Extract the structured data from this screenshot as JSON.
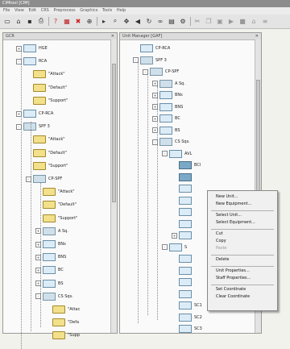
{
  "window": {
    "title": "CIMtool [CIM]"
  },
  "menu": [
    "File",
    "View",
    "Edit",
    "CRS",
    "Preprocess",
    "Graphics",
    "Tools",
    "Help"
  ],
  "toolbar_icons": [
    "new-icon",
    "open-icon",
    "save-icon",
    "print-icon",
    "help-icon",
    "grid-icon",
    "delete-icon",
    "zoom-icon",
    "select-icon",
    "search-icon",
    "pan-icon",
    "back-icon",
    "refresh-icon",
    "link-icon",
    "chart-icon",
    "settings-icon",
    "cut-icon",
    "copy-icon",
    "paste-icon",
    "forward-icon",
    "stop-icon",
    "home-icon",
    "layers-icon"
  ],
  "left_panel": {
    "title": "GCR",
    "rows": [
      {
        "label": "HGE",
        "icon": "unit",
        "exp": "+"
      },
      {
        "label": "RCA",
        "icon": "unit",
        "exp": "-"
      },
      {
        "label": "\"Attack\"",
        "icon": "folder",
        "exp": ""
      },
      {
        "label": "\"Default\"",
        "icon": "folder",
        "exp": ""
      },
      {
        "label": "\"Support\"",
        "icon": "folder",
        "exp": ""
      },
      {
        "label": "CP-RCA",
        "icon": "unit",
        "exp": "+"
      },
      {
        "label": "SPF 3",
        "icon": "gear",
        "exp": "-"
      },
      {
        "label": "\"Attack\"",
        "icon": "folder",
        "exp": ""
      },
      {
        "label": "\"Default\"",
        "icon": "folder",
        "exp": ""
      },
      {
        "label": "\"Support\"",
        "icon": "folder",
        "exp": ""
      },
      {
        "label": "CP-SPF",
        "icon": "gear",
        "exp": "-"
      },
      {
        "label": "\"Attack\"",
        "icon": "folder",
        "exp": ""
      },
      {
        "label": "\"Default\"",
        "icon": "folder",
        "exp": ""
      },
      {
        "label": "\"Support\"",
        "icon": "folder",
        "exp": ""
      },
      {
        "label": "A Sq.",
        "icon": "gear",
        "exp": "+"
      },
      {
        "label": "BNs",
        "icon": "unit",
        "exp": "+"
      },
      {
        "label": "BNS",
        "icon": "unit",
        "exp": "+"
      },
      {
        "label": "BC",
        "icon": "unit",
        "exp": "+"
      },
      {
        "label": "BS",
        "icon": "unit",
        "exp": "+"
      },
      {
        "label": "CS Sqs.",
        "icon": "gear",
        "exp": "-"
      },
      {
        "label": "\"Attac",
        "icon": "folder",
        "exp": ""
      },
      {
        "label": "\"Defa",
        "icon": "folder",
        "exp": ""
      },
      {
        "label": "\"Supp",
        "icon": "folder",
        "exp": ""
      }
    ]
  },
  "right_panel": {
    "title": "Unit Manager [GAF]",
    "rows": [
      {
        "label": "CP-RCA",
        "icon": "unit",
        "exp": ""
      },
      {
        "label": "SPF 3",
        "icon": "gear",
        "exp": "-"
      },
      {
        "label": "CP-SPF",
        "icon": "gear",
        "exp": "-"
      },
      {
        "label": "A Sq.",
        "icon": "gear",
        "exp": "+"
      },
      {
        "label": "BNs",
        "icon": "unit",
        "exp": "+"
      },
      {
        "label": "BNS",
        "icon": "unit",
        "exp": "+"
      },
      {
        "label": "BC",
        "icon": "unit",
        "exp": "+"
      },
      {
        "label": "BS",
        "icon": "unit",
        "exp": "+"
      },
      {
        "label": "CS Sqs.",
        "icon": "gear",
        "exp": "-"
      },
      {
        "label": "AVL",
        "icon": "unit",
        "exp": "-"
      },
      {
        "label": "BCI",
        "icon": "block",
        "exp": ""
      },
      {
        "label": "",
        "icon": "block",
        "exp": "",
        "selected": true
      },
      {
        "label": "",
        "icon": "unit",
        "exp": ""
      },
      {
        "label": "",
        "icon": "unit",
        "exp": ""
      },
      {
        "label": "",
        "icon": "unit",
        "exp": ""
      },
      {
        "label": "",
        "icon": "unit",
        "exp": ""
      },
      {
        "label": "",
        "icon": "unit",
        "exp": "+"
      },
      {
        "label": "S",
        "icon": "unit",
        "exp": "-"
      },
      {
        "label": "",
        "icon": "unit",
        "exp": ""
      },
      {
        "label": "",
        "icon": "unit",
        "exp": ""
      },
      {
        "label": "",
        "icon": "unit",
        "exp": ""
      },
      {
        "label": "",
        "icon": "unit",
        "exp": ""
      },
      {
        "label": "SC1",
        "icon": "unit",
        "exp": ""
      },
      {
        "label": "SC2",
        "icon": "unit",
        "exp": ""
      },
      {
        "label": "SC3",
        "icon": "unit",
        "exp": ""
      }
    ]
  },
  "context_menu": {
    "items": [
      {
        "label": "New Unit...",
        "disabled": false
      },
      {
        "label": "New Equipment...",
        "disabled": false
      },
      {
        "sep": true
      },
      {
        "label": "Select Unit...",
        "disabled": false
      },
      {
        "label": "Select Equipment...",
        "disabled": false
      },
      {
        "sep": true
      },
      {
        "label": "Cut",
        "disabled": false
      },
      {
        "label": "Copy",
        "disabled": false
      },
      {
        "label": "Paste",
        "disabled": true
      },
      {
        "sep": true
      },
      {
        "label": "Delete",
        "disabled": false
      },
      {
        "sep": true
      },
      {
        "label": "Unit Properties...",
        "disabled": false
      },
      {
        "label": "Staff Properties...",
        "disabled": false
      },
      {
        "sep": true
      },
      {
        "label": "Set Coordinate",
        "disabled": false
      },
      {
        "label": "Clear Coordinate",
        "disabled": false
      }
    ]
  }
}
